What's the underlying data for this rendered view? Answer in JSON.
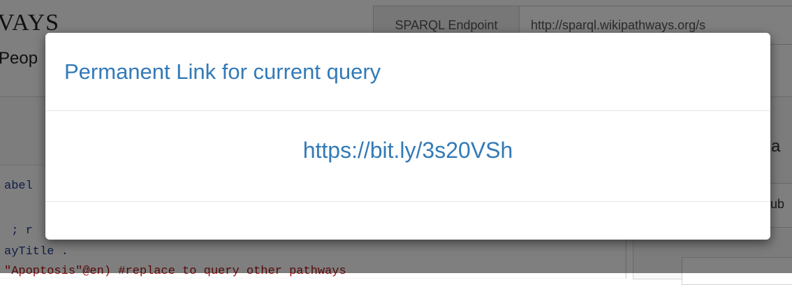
{
  "background": {
    "brand_title": "VAYS",
    "brand_subtitle": "Peop",
    "endpoint_label": "SPARQL Endpoint",
    "endpoint_value": "http://sparql.wikipathways.org/s",
    "code_lines": [
      {
        "text": "abel"
      },
      {
        "text": " ; r"
      },
      {
        "text": "ayTitle ."
      },
      {
        "text": "\"Apoptosis\"@en) #replace to query other pathways"
      }
    ],
    "right_heading": "xa",
    "right_box_text": "ıub"
  },
  "modal": {
    "title": "Permanent Link for current query",
    "link": "https://bit.ly/3s20VSh"
  },
  "colors": {
    "link": "#337ab7",
    "backdrop": "rgba(0,0,0,0.5)"
  }
}
